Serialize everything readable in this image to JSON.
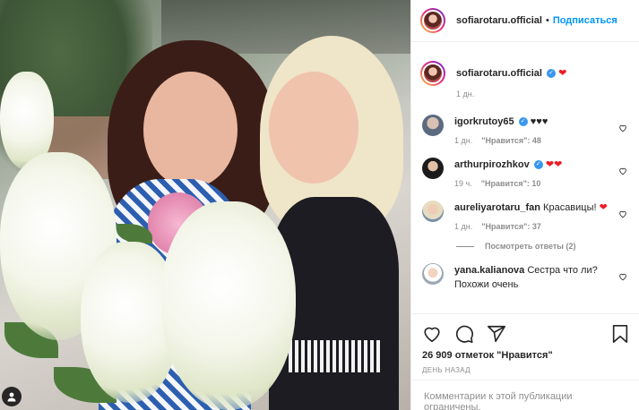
{
  "post": {
    "author": "sofiarotaru.official",
    "follow_label": "Подписаться",
    "dot": "•"
  },
  "caption": {
    "username": "sofiarotaru.official",
    "time": "1 дн."
  },
  "comments": [
    {
      "username": "igorkrutoy65",
      "verified": true,
      "text": "♥♥♥",
      "time": "1 дн.",
      "likes": "\"Нравится\": 48"
    },
    {
      "username": "arthurpirozhkov",
      "verified": true,
      "text": "",
      "time": "19 ч.",
      "likes": "\"Нравится\": 10"
    },
    {
      "username": "aureliyarotaru_fan",
      "verified": false,
      "text": "Красавицы!",
      "time": "1 дн.",
      "likes": "\"Нравится\": 37",
      "replies": "Посмотреть ответы (2)"
    },
    {
      "username": "yana.kalianova",
      "verified": false,
      "text": "Сестра что ли?",
      "text2": "Похожи очень",
      "time": "",
      "likes": ""
    }
  ],
  "likes_line": "26 909 отметок \"Нравится\"",
  "date_line": "ДЕНЬ НАЗАД",
  "comments_limited": "Комментарии к этой публикации ограничены.",
  "colors": {
    "accent_blue": "#0095f6",
    "heart_red": "#ed1c24",
    "muted": "#8e8e8e"
  },
  "icons": [
    "heart-icon",
    "comment-icon",
    "share-icon",
    "bookmark-icon",
    "verified-icon",
    "user-tag-icon"
  ]
}
